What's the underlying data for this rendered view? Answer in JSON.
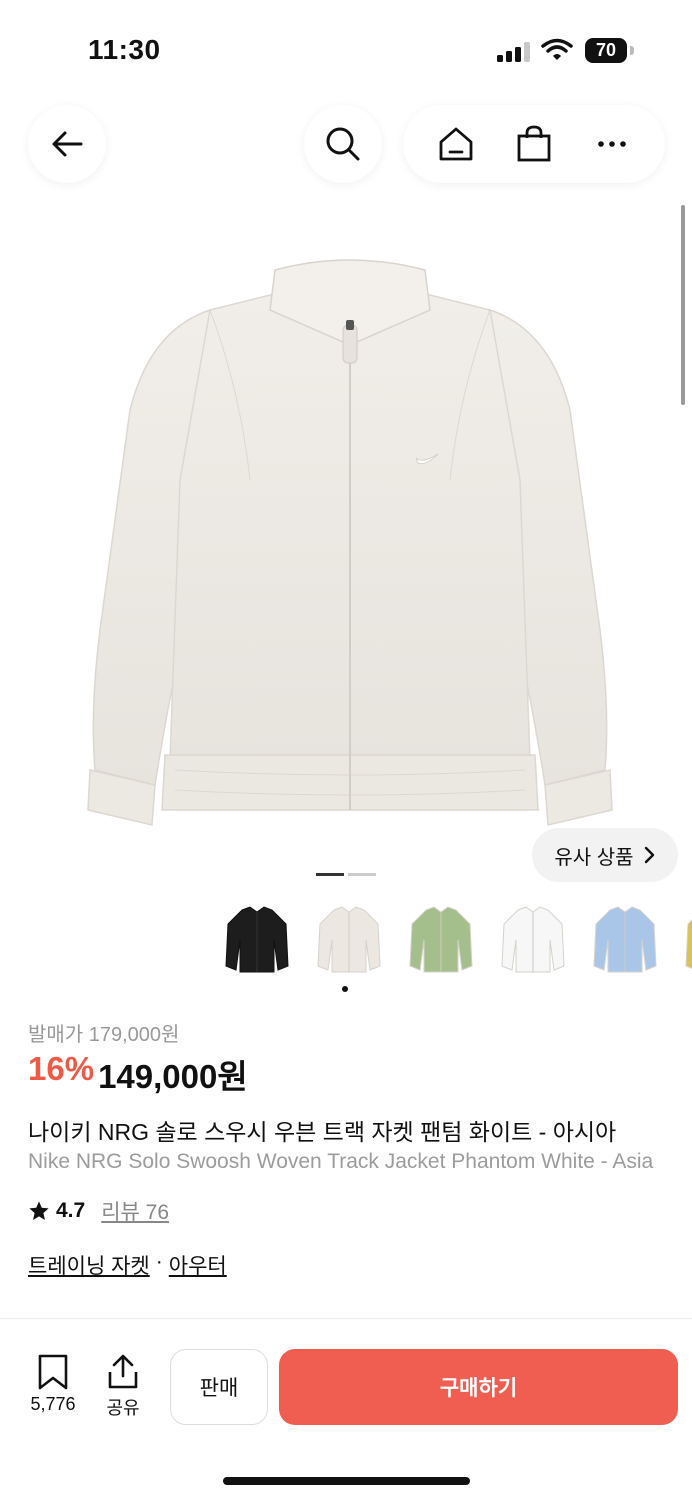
{
  "status_bar": {
    "time": "11:30",
    "battery": "70"
  },
  "header": {
    "back_icon": "arrow-left-icon",
    "search_icon": "search-icon",
    "home_icon": "home-icon",
    "bag_icon": "shopping-bag-icon",
    "more_icon": "more-dots-icon"
  },
  "gallery": {
    "similar_label": "유사 상품",
    "similar_icon": "chevron-right-icon"
  },
  "color_options": [
    {
      "name": "black",
      "color": "#1d1d1d"
    },
    {
      "name": "phantom",
      "color": "#ece8e1"
    },
    {
      "name": "green",
      "color": "#a5bf8c"
    },
    {
      "name": "white",
      "color": "#f7f7f7"
    },
    {
      "name": "blue",
      "color": "#a9c6e8"
    },
    {
      "name": "yellow",
      "color": "#d9c15b"
    }
  ],
  "product": {
    "release_price": "발매가 179,000원",
    "discount": "16%",
    "price": "149,000원",
    "name_ko": "나이키 NRG 솔로 스우시 우븐 트랙 자켓 팬텀 화이트 - 아시아",
    "name_en": "Nike NRG Solo Swoosh Woven Track Jacket Phantom White - Asia",
    "rating": "4.7",
    "review_label": "리뷰 76",
    "category_1": "트레이닝 자켓",
    "category_sep": "·",
    "category_2": "아우터"
  },
  "bottom_bar": {
    "bookmark_count": "5,776",
    "share_label": "공유",
    "sell_label": "판매",
    "buy_label": "구매하기"
  },
  "colors": {
    "accent": "#ef5a47",
    "buy_button": "#ef5e50"
  }
}
